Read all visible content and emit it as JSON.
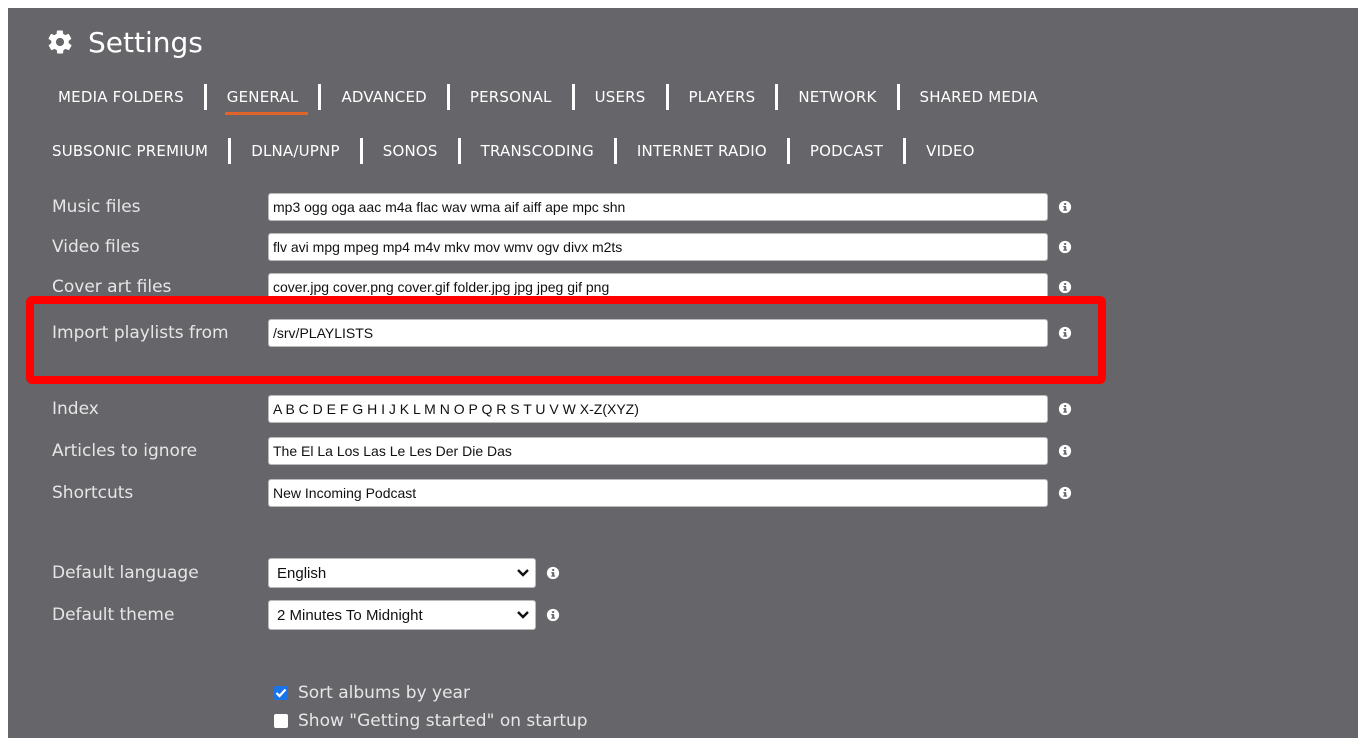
{
  "title": "Settings",
  "icons": {
    "title": "gear-icon",
    "info": "info-icon",
    "dropdown": "chevron-down-icon",
    "checked": "checkmark-icon"
  },
  "colors": {
    "background": "#66666a",
    "active_tab_underline": "#e0642a",
    "highlight": "#ff0000",
    "checkbox_on": "#1a73e8"
  },
  "nav": {
    "row1": [
      "MEDIA FOLDERS",
      "GENERAL",
      "ADVANCED",
      "PERSONAL",
      "USERS",
      "PLAYERS",
      "NETWORK",
      "SHARED MEDIA"
    ],
    "row2": [
      "SUBSONIC PREMIUM",
      "DLNA/UPNP",
      "SONOS",
      "TRANSCODING",
      "INTERNET RADIO",
      "PODCAST",
      "VIDEO"
    ],
    "active": "GENERAL"
  },
  "fields": {
    "music_files": {
      "label": "Music files",
      "value": "mp3 ogg oga aac m4a flac wav wma aif aiff ape mpc shn"
    },
    "video_files": {
      "label": "Video files",
      "value": "flv avi mpg mpeg mp4 m4v mkv mov wmv ogv divx m2ts"
    },
    "cover_art_files": {
      "label": "Cover art files",
      "value": "cover.jpg cover.png cover.gif folder.jpg jpg jpeg gif png"
    },
    "import_playlists": {
      "label": "Import playlists from",
      "value": "/srv/PLAYLISTS"
    },
    "index": {
      "label": "Index",
      "value": "A B C D E F G H I J K L M N O P Q R S T U V W X-Z(XYZ)"
    },
    "articles": {
      "label": "Articles to ignore",
      "value": "The El La Los Las Le Les Der Die Das"
    },
    "shortcuts": {
      "label": "Shortcuts",
      "value": "New Incoming Podcast"
    }
  },
  "selects": {
    "language": {
      "label": "Default language",
      "value": "English"
    },
    "theme": {
      "label": "Default theme",
      "value": "2 Minutes To Midnight"
    }
  },
  "checkboxes": {
    "sort_albums": {
      "label": "Sort albums by year",
      "checked": true
    },
    "getting_started": {
      "label": "Show \"Getting started\" on startup",
      "checked": false
    }
  }
}
